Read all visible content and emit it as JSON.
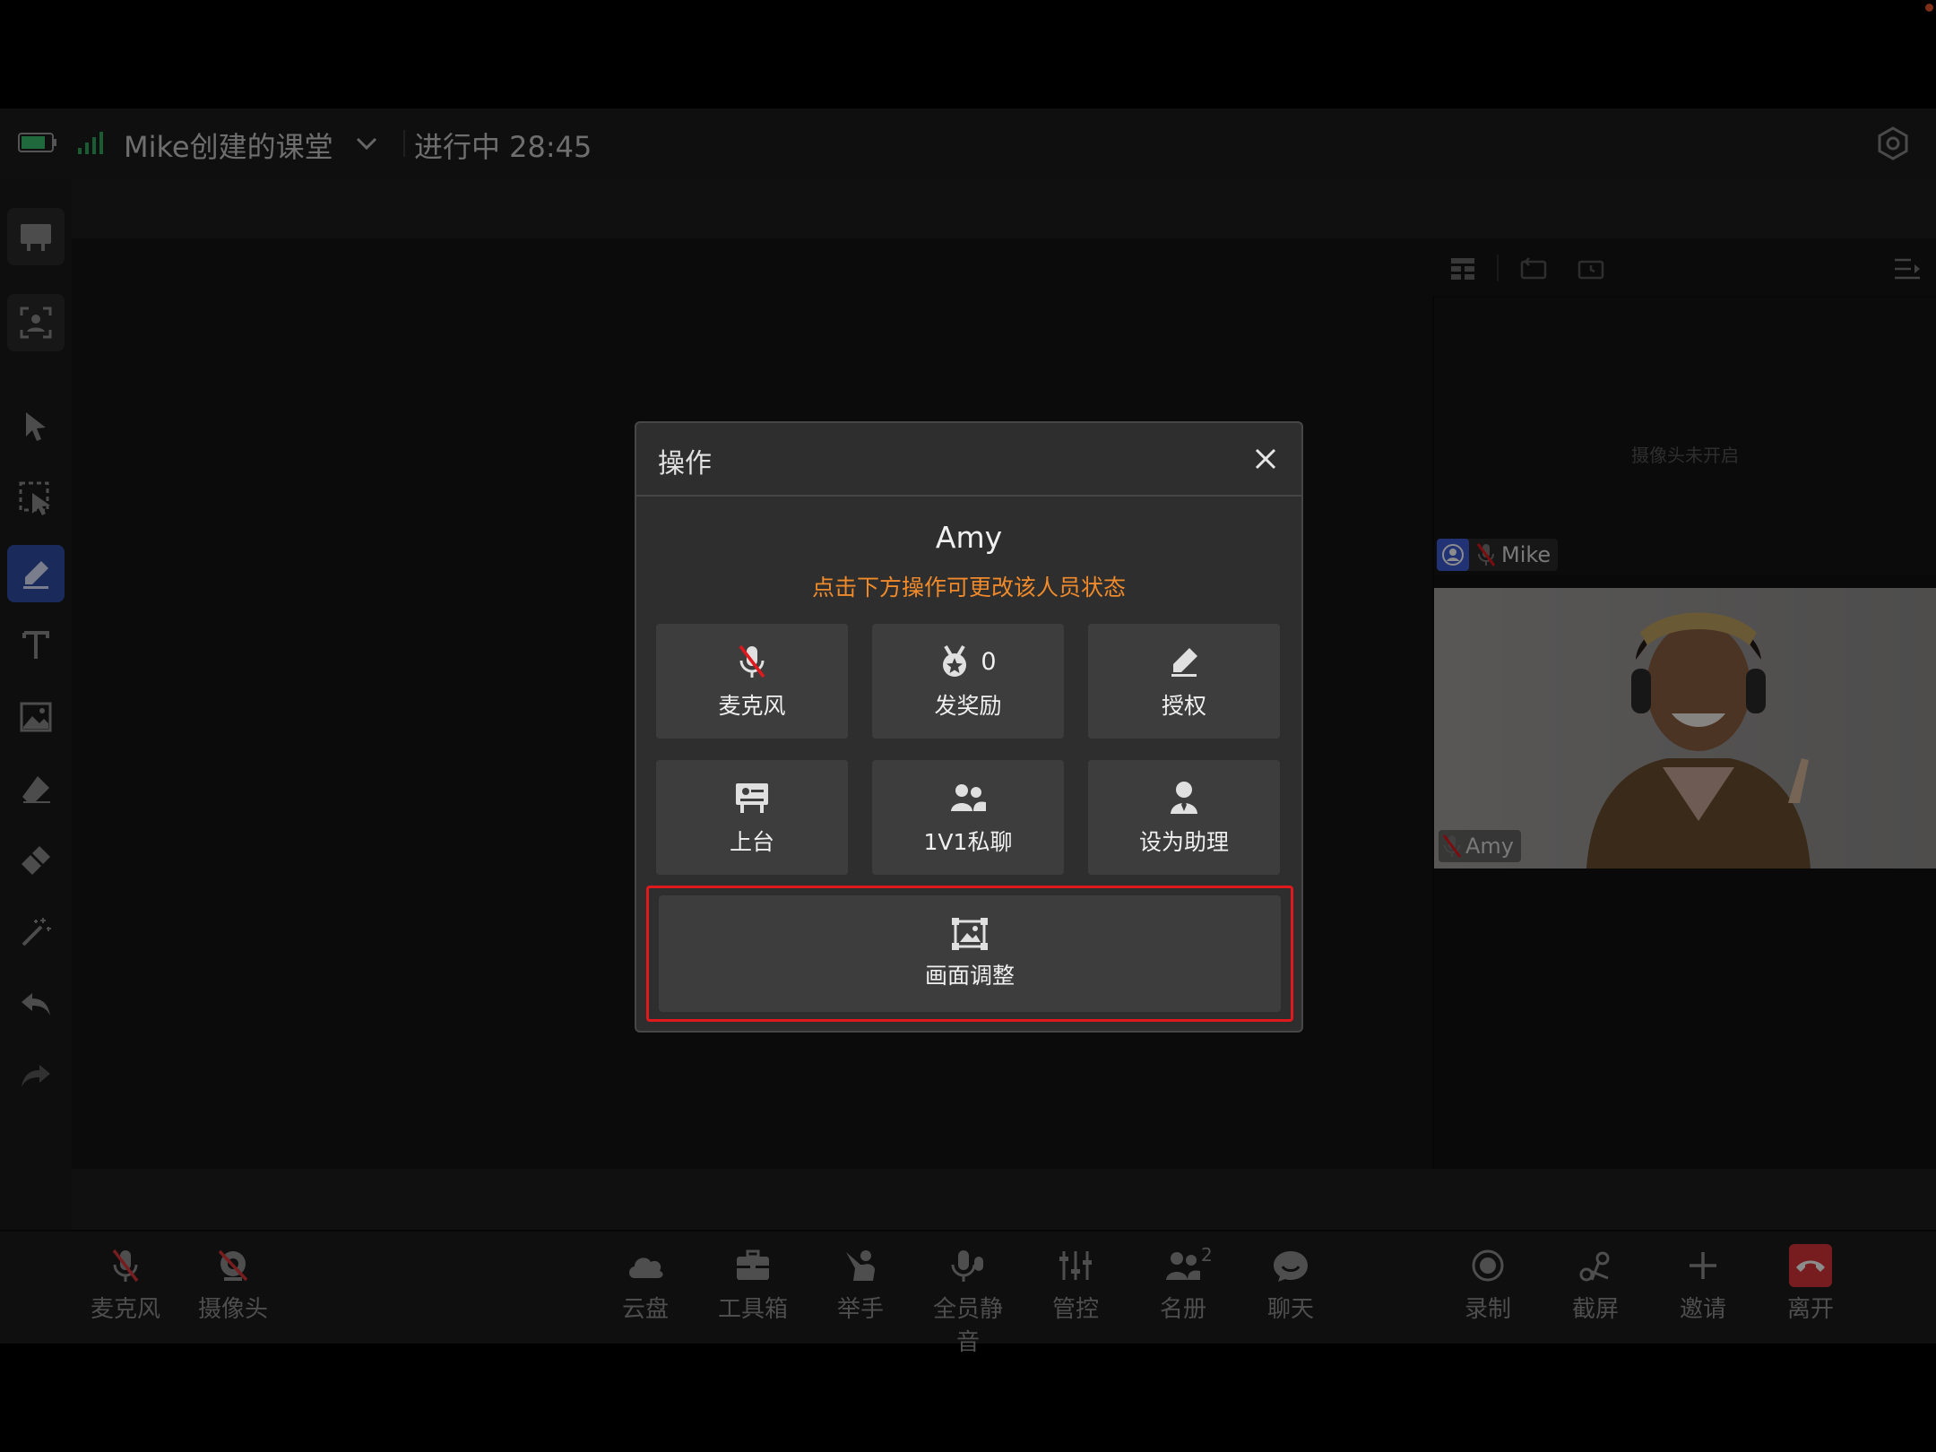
{
  "header": {
    "class_title": "Mike创建的课堂",
    "status": "进行中 28:45"
  },
  "right_panel": {
    "camera_off_text": "摄像头未开启",
    "teacher_name": "Mike",
    "student_name": "Amy"
  },
  "bottom_bar": {
    "left": [
      {
        "label": "麦克风",
        "icon": "mic-off-icon"
      },
      {
        "label": "摄像头",
        "icon": "camera-off-icon"
      }
    ],
    "center": [
      {
        "label": "云盘",
        "icon": "cloud-icon"
      },
      {
        "label": "工具箱",
        "icon": "toolbox-icon"
      },
      {
        "label": "举手",
        "icon": "raise-hand-icon"
      },
      {
        "label": "全员静音",
        "icon": "mute-all-icon"
      },
      {
        "label": "管控",
        "icon": "control-icon"
      },
      {
        "label": "名册",
        "icon": "roster-icon",
        "badge": "2"
      },
      {
        "label": "聊天",
        "icon": "chat-icon"
      }
    ],
    "right": [
      {
        "label": "录制",
        "icon": "record-icon"
      },
      {
        "label": "截屏",
        "icon": "screenshot-icon"
      },
      {
        "label": "邀请",
        "icon": "invite-icon"
      },
      {
        "label": "离开",
        "icon": "hangup-icon"
      }
    ]
  },
  "dialog": {
    "title": "操作",
    "name": "Amy",
    "hint": "点击下方操作可更改该人员状态",
    "actions": [
      {
        "label": "麦克风",
        "icon": "mic-off-icon"
      },
      {
        "label": "发奖励",
        "icon": "medal-icon",
        "count": "0"
      },
      {
        "label": "授权",
        "icon": "pen-icon"
      },
      {
        "label": "上台",
        "icon": "podium-icon"
      },
      {
        "label": "1V1私聊",
        "icon": "people-icon"
      },
      {
        "label": "设为助理",
        "icon": "assistant-icon"
      }
    ],
    "adjust_label": "画面调整"
  },
  "colors": {
    "accent": "#2f4da6",
    "hint": "#f08a2a",
    "highlight": "#e0191e",
    "hangup": "#d9353a"
  }
}
